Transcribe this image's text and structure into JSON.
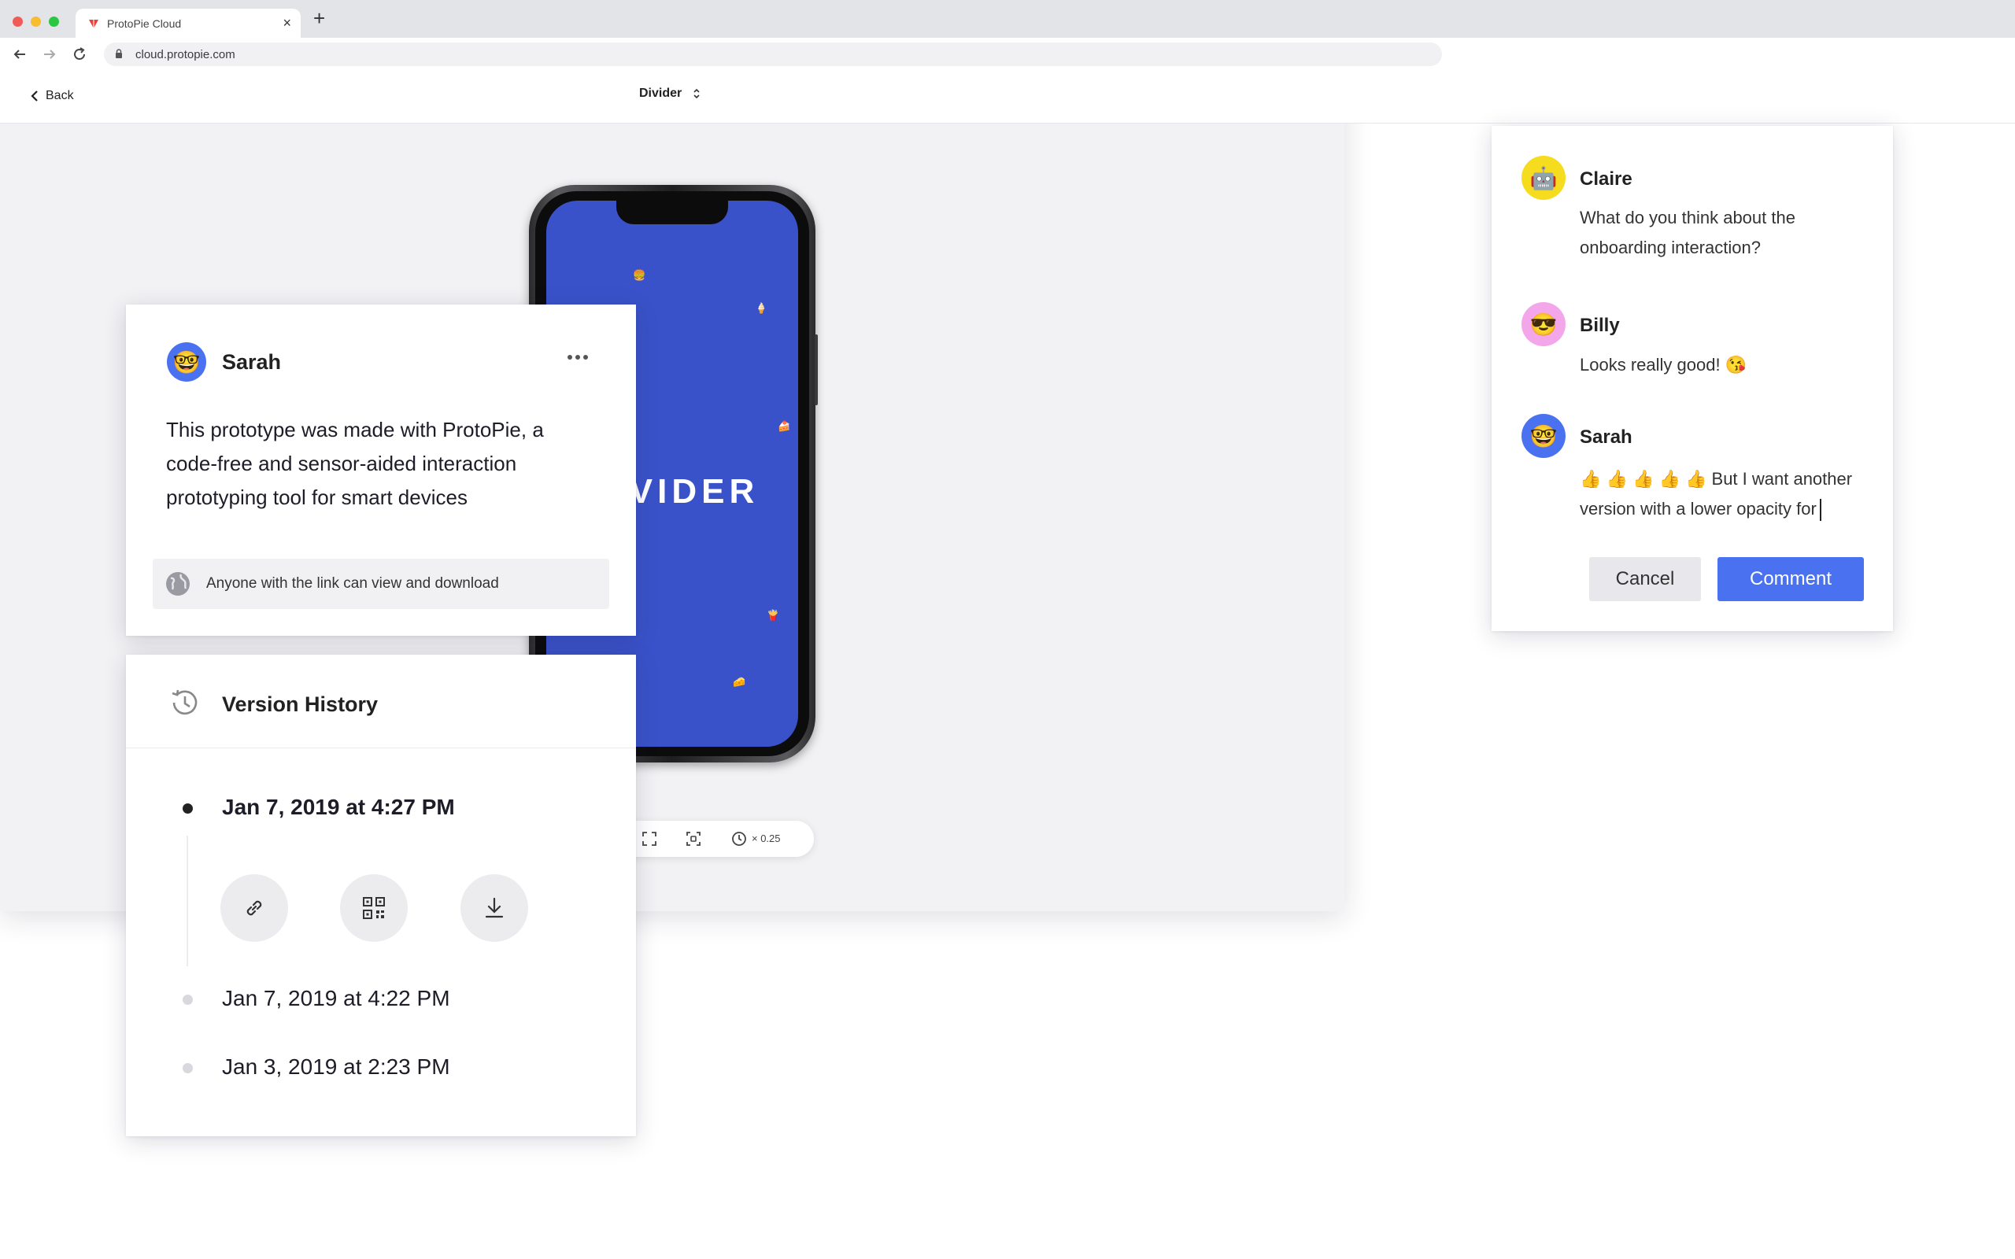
{
  "browser": {
    "tab_title": "ProtoPie Cloud",
    "url": "cloud.protopie.com",
    "close_symbol": "×",
    "new_tab_symbol": "+"
  },
  "app_header": {
    "back_label": "Back",
    "project_name": "Divider"
  },
  "phone": {
    "screen_title": "DIVIDER",
    "screen_color": "#3a52c9"
  },
  "playback": {
    "speed_label": "× 0.25"
  },
  "description": {
    "author": "Sarah",
    "text": "This prototype was made with ProtoPie, a code-free and sensor-aided interaction prototyping tool for smart devices",
    "share_text": "Anyone with the link can view and download"
  },
  "version_history": {
    "title": "Version History",
    "versions": [
      {
        "date": "Jan 7, 2019 at 4:27 PM",
        "current": true
      },
      {
        "date": "Jan 7, 2019 at 4:22 PM",
        "current": false
      },
      {
        "date": "Jan 3, 2019 at 2:23 PM",
        "current": false
      }
    ]
  },
  "comments": {
    "items": [
      {
        "author": "Claire",
        "text": "What do you think about the onboarding interaction?",
        "avatar_color": "#f5dc1e",
        "avatar_emoji": "🤖"
      },
      {
        "author": "Billy",
        "text": "Looks really good! 😘",
        "avatar_color": "#f4a6ea",
        "avatar_emoji": "😎"
      },
      {
        "author": "Sarah",
        "text": "👍 👍 👍 👍 👍 But I want another version with a lower opacity for",
        "avatar_color": "#4a72f0",
        "avatar_emoji": "🤓"
      }
    ],
    "cancel_label": "Cancel",
    "comment_label": "Comment"
  },
  "colors": {
    "accent": "#4a72f0",
    "phone_screen": "#3a52c9"
  }
}
